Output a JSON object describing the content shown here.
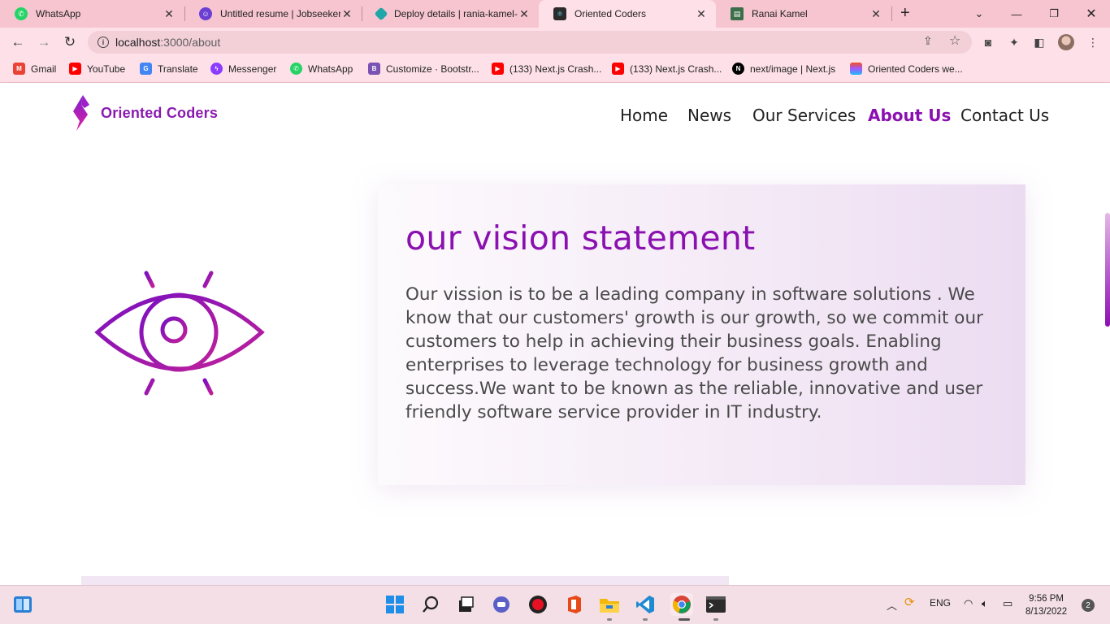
{
  "browser": {
    "tabs": [
      {
        "title": "WhatsApp",
        "icon": "whatsapp-icon",
        "color": "#25d366"
      },
      {
        "title": "Untitled resume | Jobseeker",
        "icon": "jobseeker-icon",
        "color": "#6b3fd4"
      },
      {
        "title": "Deploy details | rania-kamel-",
        "icon": "netlify-icon",
        "color": "#20a6a8"
      },
      {
        "title": "Oriented Coders",
        "icon": "react-icon",
        "color": "#2b2b2b"
      },
      {
        "title": "Ranai Kamel",
        "icon": "portfolio-icon",
        "color": "#3c6e4a"
      }
    ],
    "url_host": "localhost",
    "url_path": ":3000/about",
    "bookmarks": [
      {
        "label": "Gmail",
        "icon": "gmail-icon",
        "color": "#ea4335"
      },
      {
        "label": "YouTube",
        "icon": "youtube-icon",
        "color": "#ff0000"
      },
      {
        "label": "Translate",
        "icon": "translate-icon",
        "color": "#4285f4"
      },
      {
        "label": "Messenger",
        "icon": "messenger-icon",
        "color": "#8b3dff"
      },
      {
        "label": "WhatsApp",
        "icon": "whatsapp-icon",
        "color": "#25d366"
      },
      {
        "label": "Customize · Bootstr...",
        "icon": "bootstrap-icon",
        "color": "#7952b3"
      },
      {
        "label": "(133) Next.js Crash...",
        "icon": "youtube-icon",
        "color": "#ff0000"
      },
      {
        "label": "(133) Next.js Crash...",
        "icon": "youtube-icon",
        "color": "#ff0000"
      },
      {
        "label": "next/image | Next.js",
        "icon": "nextjs-icon",
        "color": "#000000"
      },
      {
        "label": "Oriented Coders we...",
        "icon": "figma-icon",
        "color": "#f24e1e"
      }
    ]
  },
  "site": {
    "brand": "Oriented Coders",
    "nav": [
      "Home",
      "News",
      "Our Services",
      "About Us",
      "Contact Us"
    ],
    "active_nav": "About Us",
    "accent": "#8a10b0"
  },
  "vision": {
    "title": "our vision statement",
    "text": "Our vission is to be a leading company in software solutions . We know that our customers' growth is our growth, so we commit our customers to help in achieving their business goals. Enabling enterprises to leverage technology for business growth and success.We want to be known as the reliable, innovative and user friendly software service provider in IT industry."
  },
  "taskbar": {
    "apps": [
      "start-icon",
      "search-icon",
      "task-view-icon",
      "teams-chat-icon",
      "recorder-icon",
      "office-icon",
      "file-explorer-icon",
      "vscode-icon",
      "chrome-icon",
      "terminal-icon"
    ],
    "language": "ENG",
    "time": "9:56 PM",
    "date": "8/13/2022",
    "notifications": "2"
  }
}
